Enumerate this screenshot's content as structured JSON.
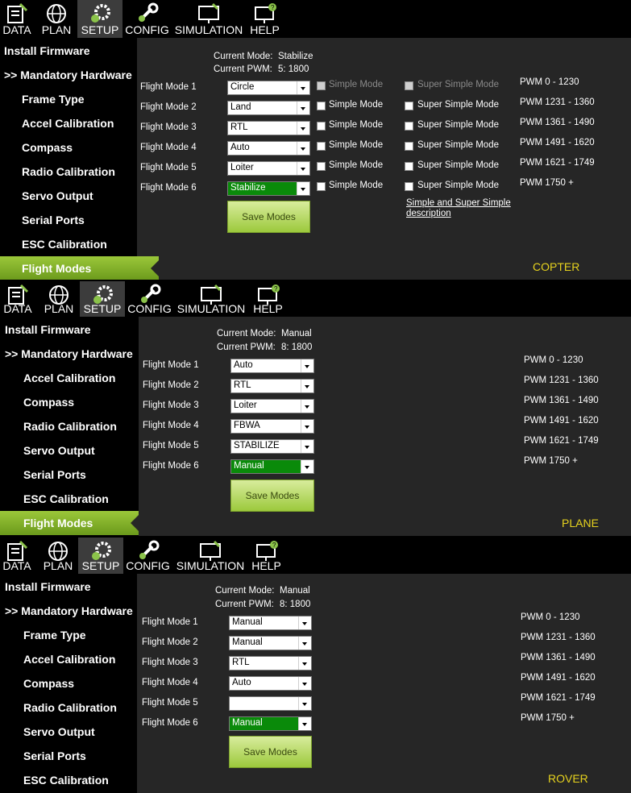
{
  "toolbar": [
    "DATA",
    "PLAN",
    "SETUP",
    "CONFIG",
    "SIMULATION",
    "HELP"
  ],
  "toolbar_icons": [
    "data-icon",
    "plan-globe-icon",
    "setup-gears-icon",
    "config-wrench-icon",
    "simulation-monitor-icon",
    "help-monitor-icon"
  ],
  "colors": {
    "active_menu": "#7fae28",
    "vehicle_label": "#e6d21e",
    "selected_mode": "#0a8a0a"
  },
  "copter": {
    "sidebar": [
      "Install Firmware",
      ">> Mandatory Hardware",
      "Frame Type",
      "Accel Calibration",
      "Compass",
      "Radio Calibration",
      "Servo Output",
      "Serial Ports",
      "ESC Calibration",
      "Flight Modes"
    ],
    "current_mode_label": "Current Mode:",
    "current_mode": "Stabilize",
    "current_pwm_label": "Current PWM:",
    "current_pwm": "5: 1800",
    "modes": [
      {
        "label": "Flight Mode 1",
        "value": "Circle",
        "simple": "Simple Mode",
        "super": "Super Simple Mode",
        "pwm": "PWM 0 - 1230"
      },
      {
        "label": "Flight Mode 2",
        "value": "Land",
        "simple": "Simple Mode",
        "super": "Super Simple Mode",
        "pwm": "PWM 1231 - 1360"
      },
      {
        "label": "Flight Mode 3",
        "value": "RTL",
        "simple": "Simple Mode",
        "super": "Super Simple Mode",
        "pwm": "PWM 1361 - 1490"
      },
      {
        "label": "Flight Mode 4",
        "value": "Auto",
        "simple": "Simple Mode",
        "super": "Super Simple Mode",
        "pwm": "PWM 1491 - 1620"
      },
      {
        "label": "Flight Mode 5",
        "value": "Loiter",
        "simple": "Simple Mode",
        "super": "Super Simple Mode",
        "pwm": "PWM 1621 - 1749"
      },
      {
        "label": "Flight Mode 6",
        "value": "Stabilize",
        "simple": "Simple Mode",
        "super": "Super Simple Mode",
        "pwm": "PWM 1750 +"
      }
    ],
    "save": "Save Modes",
    "link_line1": "Simple and Super Simple",
    "link_line2": "description",
    "vehicle": "COPTER"
  },
  "plane": {
    "sidebar": [
      "Install Firmware",
      ">> Mandatory Hardware",
      "Accel Calibration",
      "Compass",
      "Radio Calibration",
      "Servo Output",
      "Serial Ports",
      "ESC Calibration",
      "Flight Modes"
    ],
    "current_mode_label": "Current Mode:",
    "current_mode": "Manual",
    "current_pwm_label": "Current PWM:",
    "current_pwm": "8: 1800",
    "modes": [
      {
        "label": "Flight Mode 1",
        "value": "Auto",
        "pwm": "PWM 0 - 1230"
      },
      {
        "label": "Flight Mode 2",
        "value": "RTL",
        "pwm": "PWM 1231 - 1360"
      },
      {
        "label": "Flight Mode 3",
        "value": "Loiter",
        "pwm": "PWM 1361 - 1490"
      },
      {
        "label": "Flight Mode 4",
        "value": "FBWA",
        "pwm": "PWM 1491 - 1620"
      },
      {
        "label": "Flight Mode 5",
        "value": "STABILIZE",
        "pwm": "PWM 1621 - 1749"
      },
      {
        "label": "Flight Mode 6",
        "value": "Manual",
        "pwm": "PWM 1750 +"
      }
    ],
    "save": "Save Modes",
    "vehicle": "PLANE"
  },
  "rover": {
    "sidebar": [
      "Install Firmware",
      ">> Mandatory Hardware",
      "Frame Type",
      "Accel Calibration",
      "Compass",
      "Radio Calibration",
      "Servo Output",
      "Serial Ports",
      "ESC Calibration"
    ],
    "current_mode_label": "Current Mode:",
    "current_mode": "Manual",
    "current_pwm_label": "Current PWM:",
    "current_pwm": "8: 1800",
    "modes": [
      {
        "label": "Flight Mode 1",
        "value": "Manual",
        "pwm": "PWM 0 - 1230"
      },
      {
        "label": "Flight Mode 2",
        "value": "Manual",
        "pwm": "PWM 1231 - 1360"
      },
      {
        "label": "Flight Mode 3",
        "value": "RTL",
        "pwm": "PWM 1361 - 1490"
      },
      {
        "label": "Flight Mode 4",
        "value": "Auto",
        "pwm": "PWM 1491 - 1620"
      },
      {
        "label": "Flight Mode 5",
        "value": "",
        "pwm": "PWM 1621 - 1749"
      },
      {
        "label": "Flight Mode 6",
        "value": "Manual",
        "pwm": "PWM 1750 +"
      }
    ],
    "save": "Save Modes",
    "vehicle": "ROVER"
  }
}
